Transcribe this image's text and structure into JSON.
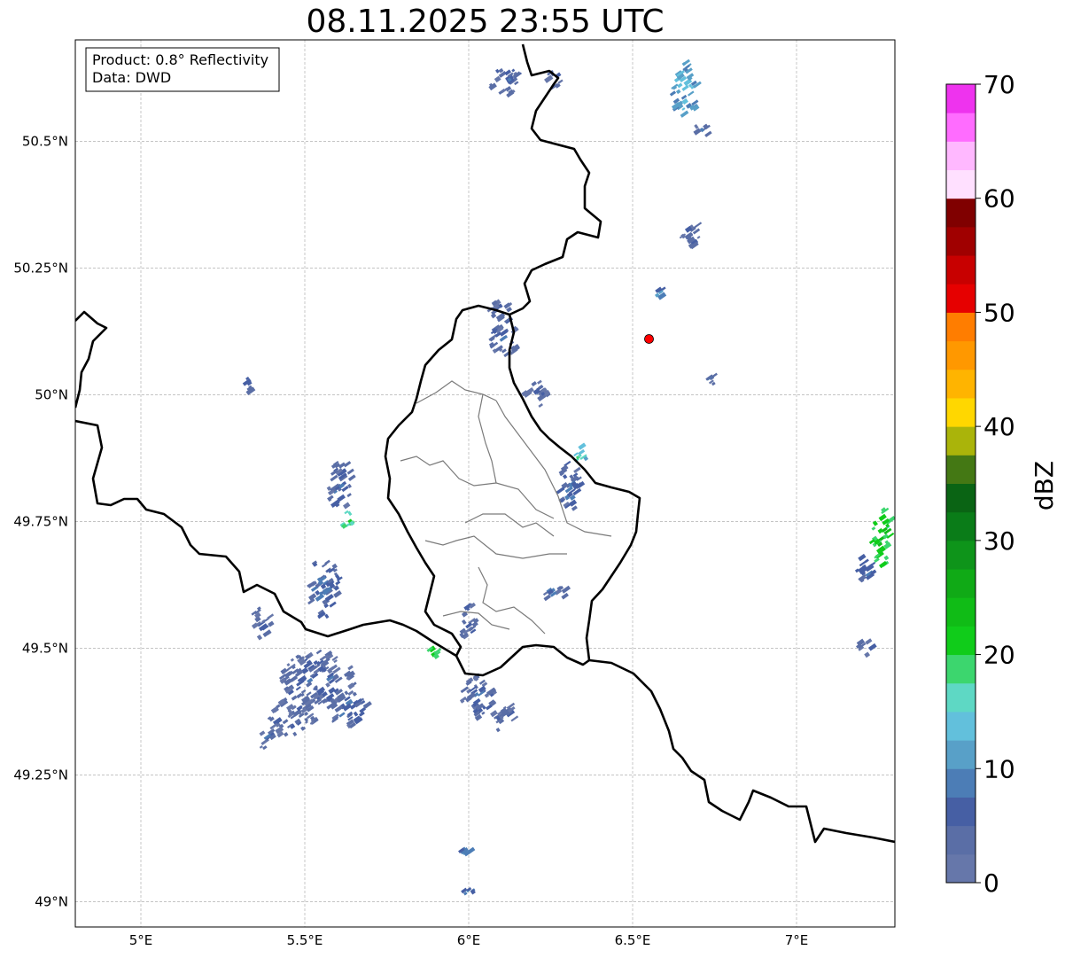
{
  "title": "08.11.2025 23:55 UTC",
  "info_box": {
    "product": "Product: 0.8° Reflectivity",
    "data": "Data: DWD"
  },
  "map": {
    "lon_range": [
      4.8,
      7.3
    ],
    "lat_range": [
      48.95,
      50.7
    ],
    "lon_ticks": [
      {
        "value": 5.0,
        "label": "5°E"
      },
      {
        "value": 5.5,
        "label": "5.5°E"
      },
      {
        "value": 6.0,
        "label": "6°E"
      },
      {
        "value": 6.5,
        "label": "6.5°E"
      },
      {
        "value": 7.0,
        "label": "7°E"
      }
    ],
    "lat_ticks": [
      {
        "value": 49.0,
        "label": "49°N"
      },
      {
        "value": 49.25,
        "label": "49.25°N"
      },
      {
        "value": 49.5,
        "label": "49.5°N"
      },
      {
        "value": 49.75,
        "label": "49.75°N"
      },
      {
        "value": 50.0,
        "label": "50°N"
      },
      {
        "value": 50.25,
        "label": "50.25°N"
      },
      {
        "value": 50.5,
        "label": "50.5°N"
      }
    ],
    "marker": {
      "lon": 6.55,
      "lat": 50.11,
      "color": "#ff0000"
    }
  },
  "colorbar": {
    "label": "dBZ",
    "min": 0,
    "max": 70,
    "step": 2.5,
    "colors": [
      "#6677aa",
      "#5a6ea6",
      "#465fa4",
      "#4c7db6",
      "#58a0c8",
      "#62c0dc",
      "#5ed8c4",
      "#3cd66e",
      "#10cc1a",
      "#10bc16",
      "#10aa16",
      "#0e941a",
      "#0a7c18",
      "#0a6414",
      "#447814",
      "#aab40a",
      "#ffd700",
      "#ffb400",
      "#ff9800",
      "#ff7d00",
      "#e60000",
      "#c80000",
      "#a00000",
      "#800000",
      "#ffe0ff",
      "#ffb8ff",
      "#ff6cff",
      "#ee33ee"
    ],
    "ticks": [
      {
        "value": 0,
        "label": "0"
      },
      {
        "value": 10,
        "label": "10"
      },
      {
        "value": 20,
        "label": "20"
      },
      {
        "value": 30,
        "label": "30"
      },
      {
        "value": 40,
        "label": "40"
      },
      {
        "value": 50,
        "label": "50"
      },
      {
        "value": 60,
        "label": "60"
      },
      {
        "value": 70,
        "label": "70"
      }
    ]
  },
  "echoes": [
    {
      "lon": 5.53,
      "lat": 49.44,
      "w": 0.22,
      "h": 0.11,
      "dbz": 6
    },
    {
      "lon": 5.45,
      "lat": 49.36,
      "w": 0.14,
      "h": 0.08,
      "dbz": 5
    },
    {
      "lon": 5.62,
      "lat": 49.38,
      "w": 0.12,
      "h": 0.07,
      "dbz": 7
    },
    {
      "lon": 5.55,
      "lat": 49.62,
      "w": 0.1,
      "h": 0.12,
      "dbz": 7
    },
    {
      "lon": 5.6,
      "lat": 49.82,
      "w": 0.08,
      "h": 0.1,
      "dbz": 6
    },
    {
      "lon": 5.62,
      "lat": 49.76,
      "w": 0.05,
      "h": 0.04,
      "dbz": 20
    },
    {
      "lon": 5.36,
      "lat": 49.55,
      "w": 0.06,
      "h": 0.06,
      "dbz": 5
    },
    {
      "lon": 6.02,
      "lat": 49.4,
      "w": 0.1,
      "h": 0.09,
      "dbz": 6
    },
    {
      "lon": 6.1,
      "lat": 49.36,
      "w": 0.08,
      "h": 0.05,
      "dbz": 5
    },
    {
      "lon": 5.99,
      "lat": 49.55,
      "w": 0.05,
      "h": 0.08,
      "dbz": 6
    },
    {
      "lon": 5.88,
      "lat": 49.49,
      "w": 0.03,
      "h": 0.02,
      "dbz": 21
    },
    {
      "lon": 6.3,
      "lat": 49.82,
      "w": 0.07,
      "h": 0.1,
      "dbz": 7
    },
    {
      "lon": 6.33,
      "lat": 49.88,
      "w": 0.04,
      "h": 0.04,
      "dbz": 16
    },
    {
      "lon": 6.25,
      "lat": 49.61,
      "w": 0.08,
      "h": 0.03,
      "dbz": 6
    },
    {
      "lon": 6.2,
      "lat": 50.0,
      "w": 0.08,
      "h": 0.05,
      "dbz": 5
    },
    {
      "lon": 6.1,
      "lat": 50.11,
      "w": 0.08,
      "h": 0.08,
      "dbz": 6
    },
    {
      "lon": 6.08,
      "lat": 50.17,
      "w": 0.07,
      "h": 0.04,
      "dbz": 5
    },
    {
      "lon": 6.1,
      "lat": 50.62,
      "w": 0.09,
      "h": 0.06,
      "dbz": 6
    },
    {
      "lon": 6.25,
      "lat": 50.62,
      "w": 0.05,
      "h": 0.03,
      "dbz": 6
    },
    {
      "lon": 6.65,
      "lat": 50.6,
      "w": 0.08,
      "h": 0.11,
      "dbz": 14
    },
    {
      "lon": 6.7,
      "lat": 50.52,
      "w": 0.06,
      "h": 0.03,
      "dbz": 6
    },
    {
      "lon": 6.67,
      "lat": 50.32,
      "w": 0.06,
      "h": 0.06,
      "dbz": 6
    },
    {
      "lon": 6.57,
      "lat": 50.2,
      "w": 0.03,
      "h": 0.02,
      "dbz": 10
    },
    {
      "lon": 6.73,
      "lat": 50.03,
      "w": 0.04,
      "h": 0.02,
      "dbz": 6
    },
    {
      "lon": 7.25,
      "lat": 49.72,
      "w": 0.06,
      "h": 0.12,
      "dbz": 22
    },
    {
      "lon": 7.2,
      "lat": 49.66,
      "w": 0.06,
      "h": 0.06,
      "dbz": 7
    },
    {
      "lon": 7.2,
      "lat": 49.5,
      "w": 0.05,
      "h": 0.03,
      "dbz": 6
    },
    {
      "lon": 5.32,
      "lat": 50.02,
      "w": 0.02,
      "h": 0.03,
      "dbz": 7
    },
    {
      "lon": 5.37,
      "lat": 49.32,
      "w": 0.05,
      "h": 0.04,
      "dbz": 6
    },
    {
      "lon": 5.98,
      "lat": 49.1,
      "w": 0.03,
      "h": 0.01,
      "dbz": 10
    },
    {
      "lon": 5.99,
      "lat": 49.02,
      "w": 0.04,
      "h": 0.01,
      "dbz": 10
    }
  ]
}
